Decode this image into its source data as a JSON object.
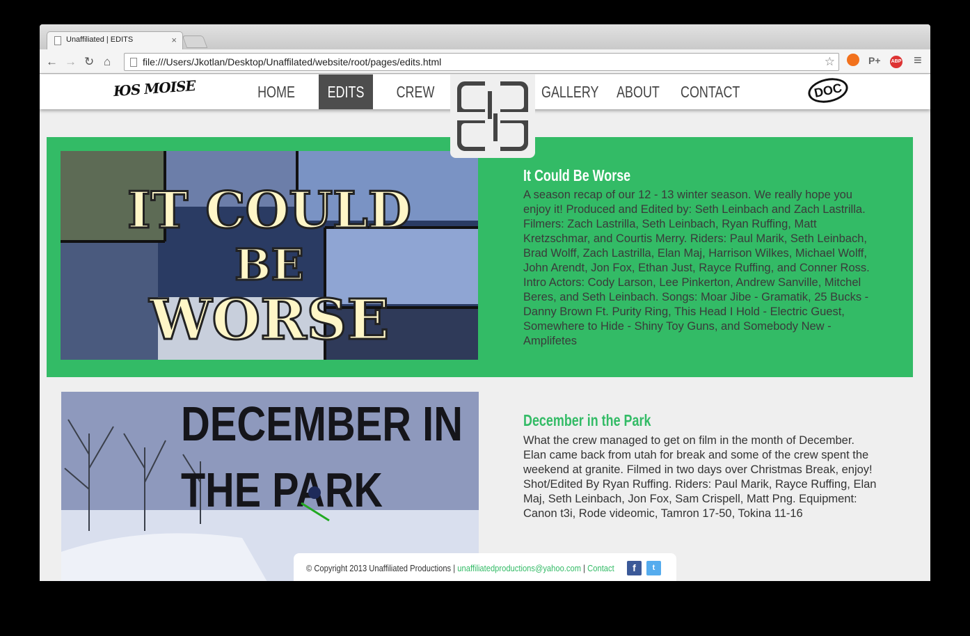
{
  "browser": {
    "tab_title": "Unaffiliated | EDITS",
    "tab_close": "×",
    "url": "file:///Users/Jkotlan/Desktop/Unaffilated/website/root/pages/edits.html",
    "back": "←",
    "forward": "→",
    "reload": "↻",
    "home": "⌂",
    "star": "☆",
    "ext_plus": "P+",
    "ext_abp": "ABP",
    "menu": "≡"
  },
  "nav": {
    "brand_left": "ЮS MOISE",
    "brand_right": "DOC",
    "items": [
      "HOME",
      "EDITS",
      "CREW",
      "GALLERY",
      "ABOUT",
      "CONTACT"
    ],
    "active": "EDITS"
  },
  "edits": [
    {
      "title": "It Could Be Worse",
      "thumb_text": [
        "IT COULD",
        "BE",
        "WORSE"
      ],
      "description": "A season recap of our 12 - 13 winter season. We really hope you enjoy it! Produced and Edited by: Seth Leinbach and Zach Lastrilla. Filmers: Zach Lastrilla, Seth Leinbach, Ryan Ruffing, Matt Kretzschmar, and Courtis Merry. Riders: Paul Marik, Seth Leinbach, Brad Wolff, Zach Lastrilla, Elan Maj, Harrison Wilkes, Michael Wolff, John Arendt, Jon Fox, Ethan Just, Rayce Ruffing, and Conner Ross. Intro Actors: Cody Larson, Lee Pinkerton, Andrew Sanville, Mitchel Beres, and Seth Leinbach. Songs: Moar Jibe - Gramatik, 25 Bucks - Danny Brown Ft. Purity Ring, This Head I Hold - Electric Guest, Somewhere to Hide - Shiny Toy Guns, and Somebody New - Amplifetes"
    },
    {
      "title": "December in the Park",
      "thumb_text": [
        "DECEMBER IN",
        "THE PARK"
      ],
      "description": "What the crew managed to get on film in the month of December. Elan came back from utah for break and some of the crew spent the weekend at granite. Filmed in two days over Christmas Break, enjoy! Shot/Edited By Ryan Ruffing. Riders: Paul Marik, Rayce Ruffing, Elan Maj, Seth Leinbach, Jon Fox, Sam Crispell, Matt Png. Equipment: Canon t3i, Rode videomic, Tamron 17-50, Tokina 11-16"
    }
  ],
  "footer": {
    "copyright": "© Copyright 2013 Unaffiliated Productions",
    "sep": "|",
    "email": "unaffiliatedproductions@yahoo.com",
    "contact": "Contact",
    "fb": "f",
    "tw": "t"
  },
  "colors": {
    "accent": "#33bb66",
    "nav_active": "#4d4d4d",
    "page_bg": "#efefef"
  }
}
